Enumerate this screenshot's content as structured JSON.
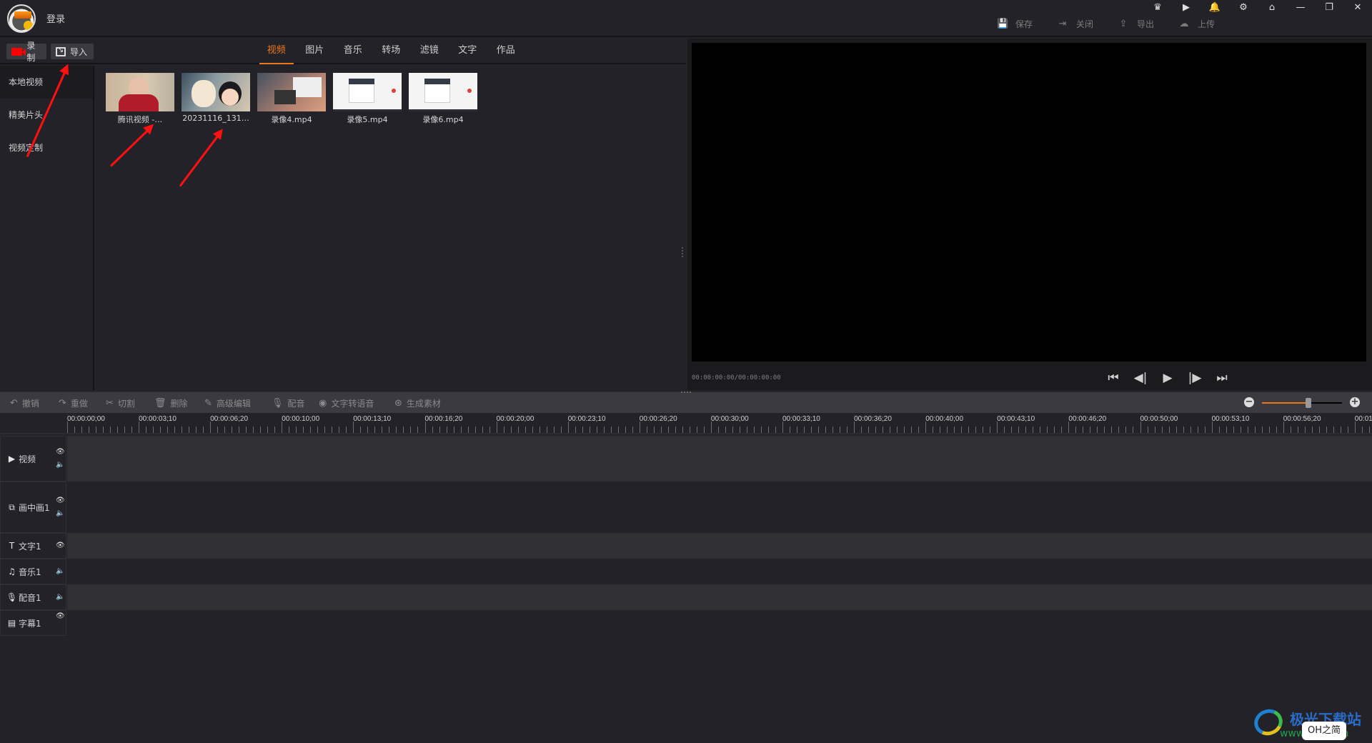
{
  "titlebar": {
    "login_label": "登录",
    "window_icons": [
      {
        "name": "vip-icon",
        "glyph": "♛"
      },
      {
        "name": "tutorial-icon",
        "glyph": "▶"
      },
      {
        "name": "qq-icon",
        "glyph": "🔔"
      },
      {
        "name": "settings-icon",
        "glyph": "⚙"
      },
      {
        "name": "home-icon",
        "glyph": "⌂"
      },
      {
        "name": "minimize-icon",
        "glyph": "—"
      },
      {
        "name": "restore-icon",
        "glyph": "❐"
      },
      {
        "name": "close-icon",
        "glyph": "✕"
      }
    ],
    "actions": [
      {
        "name": "save",
        "label": "保存",
        "icon": "save-icon",
        "glyph": "💾"
      },
      {
        "name": "close",
        "label": "关闭",
        "icon": "exit-icon",
        "glyph": "⇥"
      },
      {
        "name": "export",
        "label": "导出",
        "icon": "share-icon",
        "glyph": "⇪"
      },
      {
        "name": "upload",
        "label": "上传",
        "icon": "cloud-upload-icon",
        "glyph": "☁"
      }
    ]
  },
  "library": {
    "record_label": "录制",
    "import_label": "导入",
    "tabs": [
      "视频",
      "图片",
      "音乐",
      "转场",
      "滤镜",
      "文字",
      "作品"
    ],
    "active_tab": "视频",
    "sidebar": [
      "本地视频",
      "精美片头",
      "视频定制"
    ],
    "active_sidebar": "本地视频",
    "media": [
      {
        "label": "腾讯视频 -…"
      },
      {
        "label": "20231116_131…"
      },
      {
        "label": "录像4.mp4"
      },
      {
        "label": "录像5.mp4"
      },
      {
        "label": "录像6.mp4"
      }
    ]
  },
  "preview": {
    "timecode": "00:00:00:00/00:00:00:00",
    "controls": [
      {
        "name": "skip-start",
        "glyph": "⏮"
      },
      {
        "name": "prev-frame",
        "glyph": "◀|"
      },
      {
        "name": "play",
        "glyph": "▶"
      },
      {
        "name": "next-frame",
        "glyph": "|▶"
      },
      {
        "name": "skip-end",
        "glyph": "⏭"
      }
    ]
  },
  "edit_toolbar": {
    "items": [
      {
        "name": "undo",
        "label": "撤销",
        "glyph": "↶"
      },
      {
        "name": "redo",
        "label": "重做",
        "glyph": "↷"
      },
      {
        "name": "cut",
        "label": "切割",
        "glyph": "✂"
      },
      {
        "name": "delete",
        "label": "删除",
        "glyph": "🗑"
      },
      {
        "name": "advanced-edit",
        "label": "高级编辑",
        "glyph": "✎"
      },
      {
        "name": "voiceover",
        "label": "配音",
        "glyph": "🎙"
      },
      {
        "name": "text-to-speech",
        "label": "文字转语音",
        "glyph": "◉"
      },
      {
        "name": "generate-material",
        "label": "生成素材",
        "glyph": "⊛"
      }
    ],
    "zoom_level": 0.58
  },
  "timeline": {
    "ruler_labels": [
      "00:00:00;00",
      "00:00:03;10",
      "00:00:06;20",
      "00:00:10;00",
      "00:00:13;10",
      "00:00:16;20",
      "00:00:20;00",
      "00:00:23;10",
      "00:00:26;20",
      "00:00:30;00",
      "00:00:33;10",
      "00:00:36;20",
      "00:00:40;00",
      "00:00:43;10",
      "00:00:46;20",
      "00:00:50;00",
      "00:00:53;10",
      "00:00:56;20",
      "00:01"
    ],
    "tracks": [
      {
        "name": "video",
        "label": "视频",
        "icon": "video-track-icon",
        "glyph": "▶",
        "eye": true,
        "speaker": true
      },
      {
        "name": "pip",
        "label": "画中画1",
        "icon": "pip-icon",
        "glyph": "⧉",
        "eye": true,
        "speaker": true
      },
      {
        "name": "text",
        "label": "文字1",
        "icon": "text-icon",
        "glyph": "T",
        "eye": true,
        "speaker": false
      },
      {
        "name": "music",
        "label": "音乐1",
        "icon": "music-icon",
        "glyph": "♫",
        "eye": false,
        "speaker": true
      },
      {
        "name": "voice",
        "label": "配音1",
        "icon": "microphone-icon",
        "glyph": "🎙",
        "eye": false,
        "speaker": true
      },
      {
        "name": "subtitle",
        "label": "字幕1",
        "icon": "subtitle-icon",
        "glyph": "▤",
        "eye": true,
        "speaker": false
      }
    ]
  },
  "watermark": {
    "site": "极光下载站",
    "url": "www.xz7.com",
    "note": "OH之简"
  }
}
